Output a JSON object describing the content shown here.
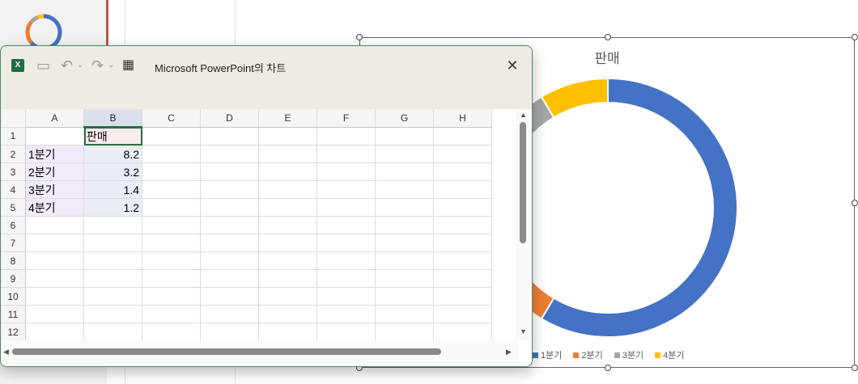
{
  "excel_window": {
    "title": "Microsoft PowerPoint의 차트",
    "close_label": "✕"
  },
  "sheet": {
    "columns": [
      "A",
      "B",
      "C",
      "D",
      "E",
      "F",
      "G",
      "H"
    ],
    "rows": [
      "1",
      "2",
      "3",
      "4",
      "5",
      "6",
      "7",
      "8",
      "9",
      "10",
      "11",
      "12"
    ],
    "header_cell": "판매",
    "data": [
      {
        "category": "1분기",
        "value": "8.2"
      },
      {
        "category": "2분기",
        "value": "3.2"
      },
      {
        "category": "3분기",
        "value": "1.4"
      },
      {
        "category": "4분기",
        "value": "1.2"
      }
    ]
  },
  "chart_data": {
    "type": "pie",
    "title": "판매",
    "categories": [
      "1분기",
      "2분기",
      "3분기",
      "4분기"
    ],
    "values": [
      8.2,
      3.2,
      1.4,
      1.2
    ],
    "colors": [
      "#4472c4",
      "#ed7d31",
      "#a5a5a5",
      "#ffc000"
    ],
    "legend_position": "bottom"
  }
}
